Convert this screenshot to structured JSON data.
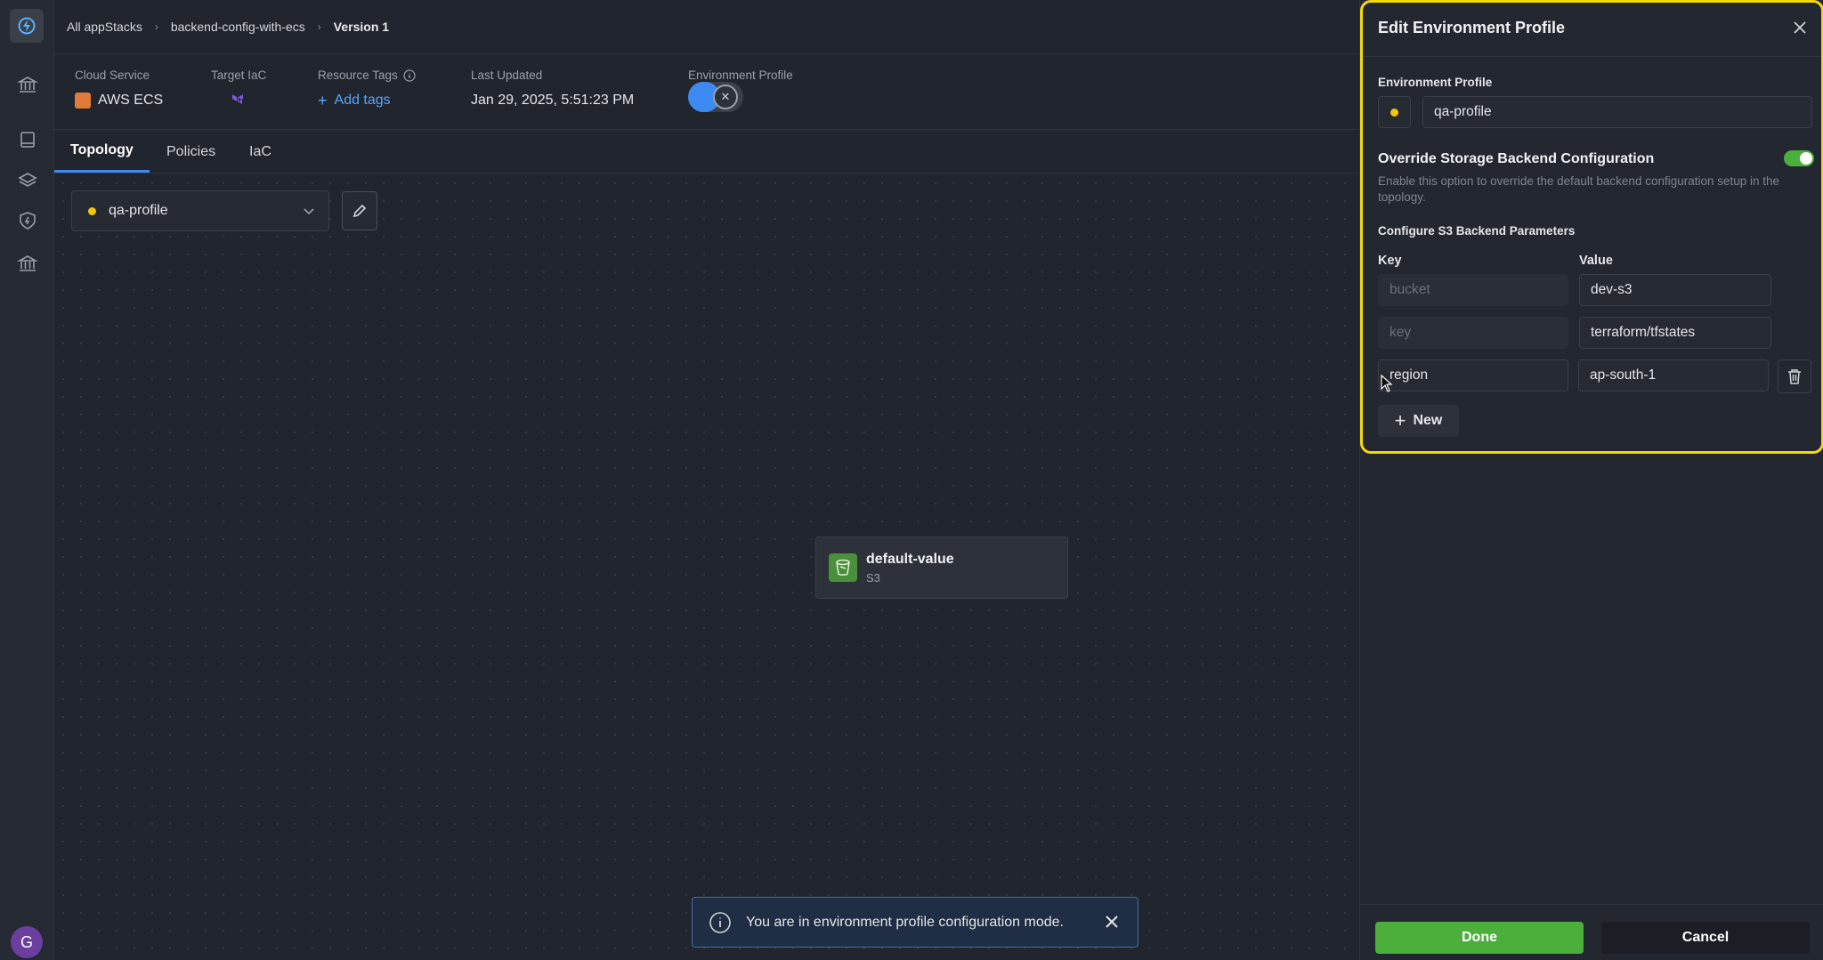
{
  "breadcrumb": {
    "items": [
      "All appStacks",
      "backend-config-with-ecs",
      "Version 1"
    ]
  },
  "info": {
    "cloud_service_label": "Cloud Service",
    "cloud_service_value": "AWS ECS",
    "target_iac_label": "Target IaC",
    "resource_tags_label": "Resource Tags",
    "add_tags_label": "Add tags",
    "last_updated_label": "Last Updated",
    "last_updated_value": "Jan 29, 2025, 5:51:23 PM",
    "env_profile_label": "Environment Profile"
  },
  "tabs": [
    "Topology",
    "Policies",
    "IaC"
  ],
  "canvas": {
    "selected_profile": "qa-profile",
    "node": {
      "title": "default-value",
      "subtitle": "S3"
    },
    "toast": "You are in environment profile configuration mode."
  },
  "panel": {
    "title": "Edit Environment Profile",
    "env_profile_label": "Environment Profile",
    "env_profile_value": "qa-profile",
    "override_title": "Override Storage Backend Configuration",
    "override_desc": "Enable this option to override the default backend configuration setup in the topology.",
    "configure_label": "Configure S3 Backend Parameters",
    "key_header": "Key",
    "value_header": "Value",
    "rows": [
      {
        "key": "bucket",
        "value": "dev-s3"
      },
      {
        "key": "key",
        "value": "terraform/tfstates"
      },
      {
        "key": "region",
        "value": "ap-south-1"
      }
    ],
    "new_label": "New",
    "done_label": "Done",
    "cancel_label": "Cancel"
  },
  "user": {
    "avatar_initial": "G"
  },
  "colors": {
    "accent": "#3d8bf2",
    "success": "#4caf3c",
    "highlight": "#f5d90a"
  }
}
